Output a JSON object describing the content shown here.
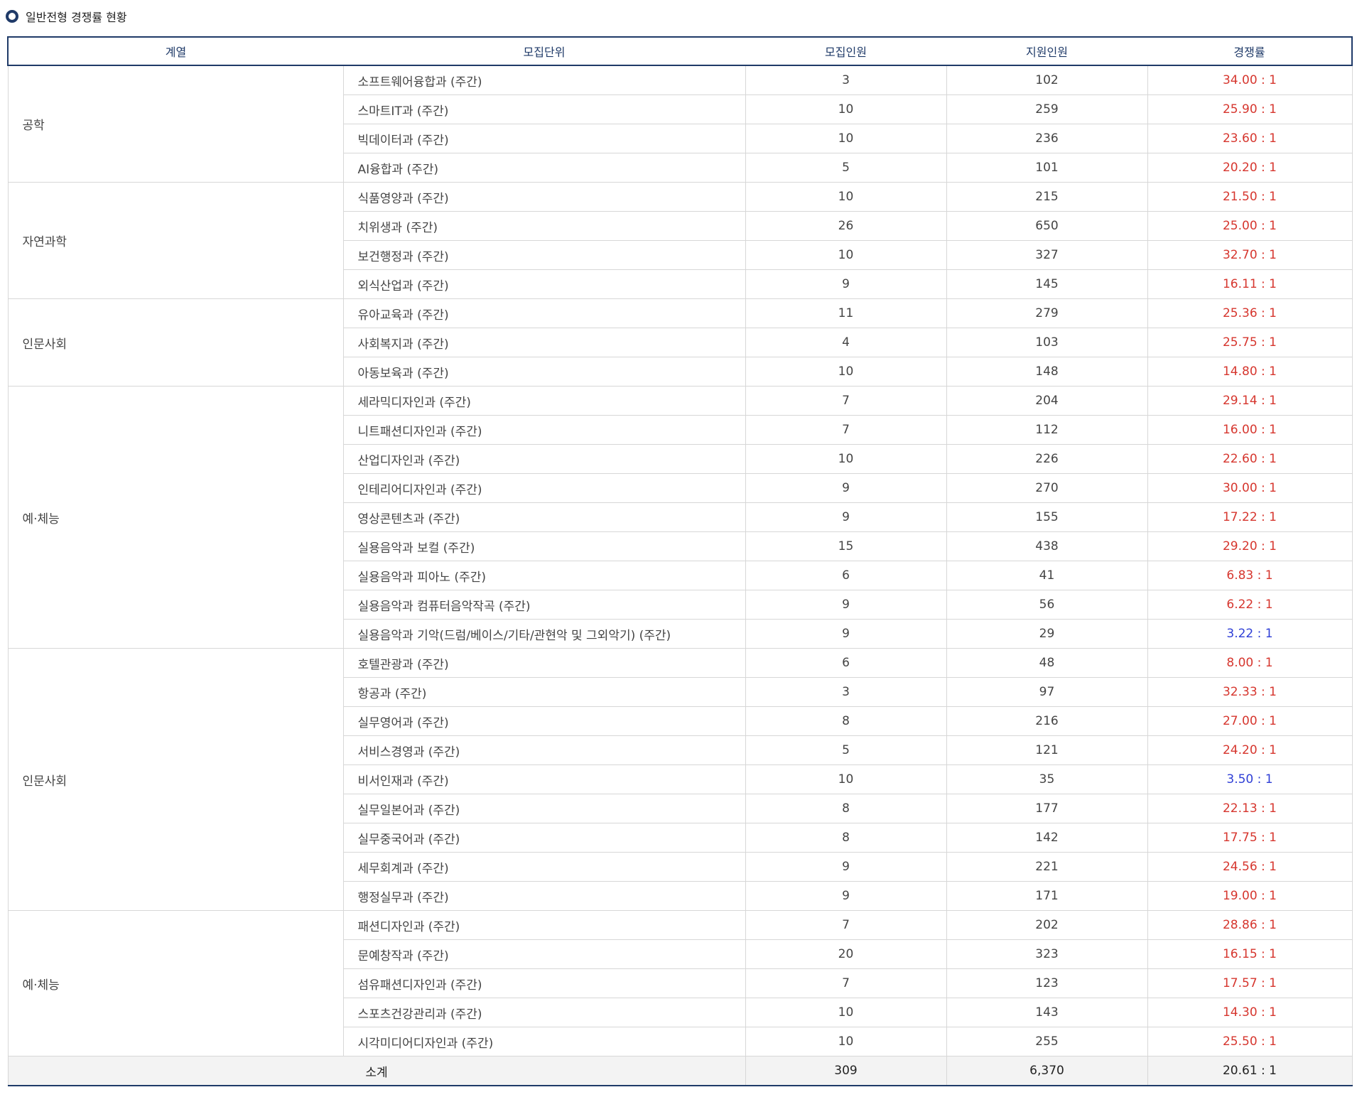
{
  "section": {
    "title": "일반전형 경쟁률 현황"
  },
  "headers": [
    "계열",
    "모집단위",
    "모집인원",
    "지원인원",
    "경쟁률"
  ],
  "colors": {
    "high_rate": "#d6362e",
    "low_rate": "#2f3fd6",
    "header": "#1f3a68"
  },
  "groups": [
    {
      "category": "공학",
      "rows": [
        {
          "unit": "소프트웨어융합과 (주간)",
          "quota": "3",
          "applicants": "102",
          "ratio": "34.00 : 1",
          "level": "high"
        },
        {
          "unit": "스마트IT과 (주간)",
          "quota": "10",
          "applicants": "259",
          "ratio": "25.90 : 1",
          "level": "high"
        },
        {
          "unit": "빅데이터과 (주간)",
          "quota": "10",
          "applicants": "236",
          "ratio": "23.60 : 1",
          "level": "high"
        },
        {
          "unit": "AI융합과 (주간)",
          "quota": "5",
          "applicants": "101",
          "ratio": "20.20 : 1",
          "level": "high"
        }
      ]
    },
    {
      "category": "자연과학",
      "rows": [
        {
          "unit": "식품영양과 (주간)",
          "quota": "10",
          "applicants": "215",
          "ratio": "21.50 : 1",
          "level": "high"
        },
        {
          "unit": "치위생과 (주간)",
          "quota": "26",
          "applicants": "650",
          "ratio": "25.00 : 1",
          "level": "high"
        },
        {
          "unit": "보건행정과 (주간)",
          "quota": "10",
          "applicants": "327",
          "ratio": "32.70 : 1",
          "level": "high"
        },
        {
          "unit": "외식산업과 (주간)",
          "quota": "9",
          "applicants": "145",
          "ratio": "16.11 : 1",
          "level": "high"
        }
      ]
    },
    {
      "category": "인문사회",
      "rows": [
        {
          "unit": "유아교육과 (주간)",
          "quota": "11",
          "applicants": "279",
          "ratio": "25.36 : 1",
          "level": "high"
        },
        {
          "unit": "사회복지과 (주간)",
          "quota": "4",
          "applicants": "103",
          "ratio": "25.75 : 1",
          "level": "high"
        },
        {
          "unit": "아동보육과 (주간)",
          "quota": "10",
          "applicants": "148",
          "ratio": "14.80 : 1",
          "level": "high"
        }
      ]
    },
    {
      "category": "예·체능",
      "rows": [
        {
          "unit": "세라믹디자인과 (주간)",
          "quota": "7",
          "applicants": "204",
          "ratio": "29.14 : 1",
          "level": "high"
        },
        {
          "unit": "니트패션디자인과 (주간)",
          "quota": "7",
          "applicants": "112",
          "ratio": "16.00 : 1",
          "level": "high"
        },
        {
          "unit": "산업디자인과 (주간)",
          "quota": "10",
          "applicants": "226",
          "ratio": "22.60 : 1",
          "level": "high"
        },
        {
          "unit": "인테리어디자인과 (주간)",
          "quota": "9",
          "applicants": "270",
          "ratio": "30.00 : 1",
          "level": "high"
        },
        {
          "unit": "영상콘텐츠과 (주간)",
          "quota": "9",
          "applicants": "155",
          "ratio": "17.22 : 1",
          "level": "high"
        },
        {
          "unit": "실용음악과 보컬 (주간)",
          "quota": "15",
          "applicants": "438",
          "ratio": "29.20 : 1",
          "level": "high"
        },
        {
          "unit": "실용음악과 피아노 (주간)",
          "quota": "6",
          "applicants": "41",
          "ratio": "6.83 : 1",
          "level": "high"
        },
        {
          "unit": "실용음악과 컴퓨터음악작곡 (주간)",
          "quota": "9",
          "applicants": "56",
          "ratio": "6.22 : 1",
          "level": "high"
        },
        {
          "unit": "실용음악과 기악(드럼/베이스/기타/관현악 및 그외악기) (주간)",
          "quota": "9",
          "applicants": "29",
          "ratio": "3.22 : 1",
          "level": "low"
        }
      ]
    },
    {
      "category": "인문사회",
      "rows": [
        {
          "unit": "호텔관광과 (주간)",
          "quota": "6",
          "applicants": "48",
          "ratio": "8.00 : 1",
          "level": "high"
        },
        {
          "unit": "항공과 (주간)",
          "quota": "3",
          "applicants": "97",
          "ratio": "32.33 : 1",
          "level": "high"
        },
        {
          "unit": "실무영어과 (주간)",
          "quota": "8",
          "applicants": "216",
          "ratio": "27.00 : 1",
          "level": "high"
        },
        {
          "unit": "서비스경영과 (주간)",
          "quota": "5",
          "applicants": "121",
          "ratio": "24.20 : 1",
          "level": "high"
        },
        {
          "unit": "비서인재과 (주간)",
          "quota": "10",
          "applicants": "35",
          "ratio": "3.50 : 1",
          "level": "low"
        },
        {
          "unit": "실무일본어과 (주간)",
          "quota": "8",
          "applicants": "177",
          "ratio": "22.13 : 1",
          "level": "high"
        },
        {
          "unit": "실무중국어과 (주간)",
          "quota": "8",
          "applicants": "142",
          "ratio": "17.75 : 1",
          "level": "high"
        },
        {
          "unit": "세무회계과 (주간)",
          "quota": "9",
          "applicants": "221",
          "ratio": "24.56 : 1",
          "level": "high"
        },
        {
          "unit": "행정실무과 (주간)",
          "quota": "9",
          "applicants": "171",
          "ratio": "19.00 : 1",
          "level": "high"
        }
      ]
    },
    {
      "category": "예·체능",
      "rows": [
        {
          "unit": "패션디자인과 (주간)",
          "quota": "7",
          "applicants": "202",
          "ratio": "28.86 : 1",
          "level": "high"
        },
        {
          "unit": "문예창작과 (주간)",
          "quota": "20",
          "applicants": "323",
          "ratio": "16.15 : 1",
          "level": "high"
        },
        {
          "unit": "섬유패션디자인과 (주간)",
          "quota": "7",
          "applicants": "123",
          "ratio": "17.57 : 1",
          "level": "high"
        },
        {
          "unit": "스포츠건강관리과 (주간)",
          "quota": "10",
          "applicants": "143",
          "ratio": "14.30 : 1",
          "level": "high"
        },
        {
          "unit": "시각미디어디자인과 (주간)",
          "quota": "10",
          "applicants": "255",
          "ratio": "25.50 : 1",
          "level": "high"
        }
      ]
    }
  ],
  "total": {
    "label": "소계",
    "quota": "309",
    "applicants": "6,370",
    "ratio": "20.61 : 1",
    "level": "high"
  }
}
